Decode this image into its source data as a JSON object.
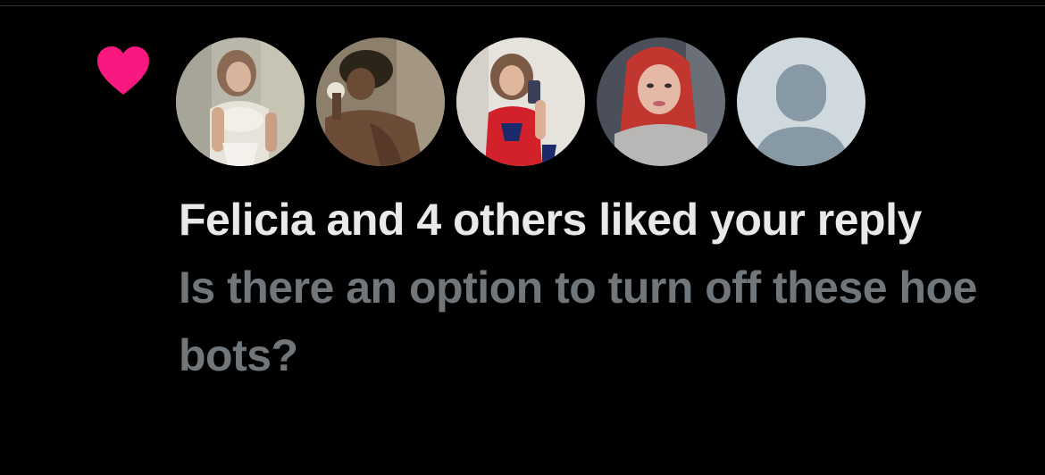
{
  "notification": {
    "type_icon": "heart-icon",
    "headline": "Felicia and 4 others liked your reply",
    "reply_text": "Is there an option to turn off these hoe bots?",
    "avatars": [
      {
        "icon": "user-photo-1"
      },
      {
        "icon": "user-photo-2"
      },
      {
        "icon": "user-photo-3"
      },
      {
        "icon": "user-photo-4"
      },
      {
        "icon": "default-avatar-icon"
      }
    ]
  },
  "colors": {
    "background": "#000000",
    "heart": "#f91880",
    "headline": "#e7e9ea",
    "reply_text": "#71767b",
    "default_avatar_bg": "#cfd9de",
    "default_avatar_figure": "#8899a6"
  }
}
